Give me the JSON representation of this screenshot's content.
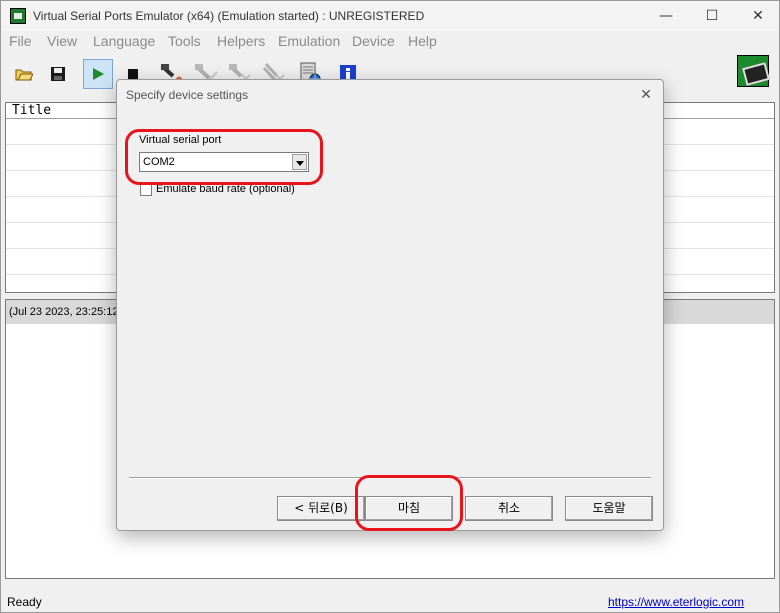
{
  "window": {
    "title": "Virtual Serial Ports Emulator (x64) (Emulation started) : UNREGISTERED",
    "minimize_glyph": "—",
    "maximize_glyph": "☐",
    "close_glyph": "✕"
  },
  "menu": [
    "File",
    "View",
    "Language",
    "Tools",
    "Helpers",
    "Emulation",
    "Device",
    "Help"
  ],
  "toolbar": {
    "icons": [
      "open-folder-icon",
      "save-icon",
      "play-icon",
      "stop-icon",
      "create-device-icon",
      "edit-device-icon",
      "delete-device-icon",
      "delete-all-icon",
      "network-icon",
      "info-icon",
      "logo-icon"
    ]
  },
  "list": {
    "header": "Title"
  },
  "log": {
    "first_entry": "(Jul 23 2023, 23:25:12)"
  },
  "status": {
    "text": "Ready",
    "link": "https://www.eterlogic.com"
  },
  "dialog": {
    "title": "Specify device settings",
    "close_glyph": "✕",
    "port_label": "Virtual serial port",
    "port_value": "COM2",
    "baud_label": "Emulate baud rate (optional)",
    "buttons": {
      "back": "< 뒤로(B)",
      "finish": "마침",
      "cancel": "취소",
      "help": "도움말"
    }
  },
  "colors": {
    "annotation": "#e8141c",
    "link": "#0000cc"
  }
}
